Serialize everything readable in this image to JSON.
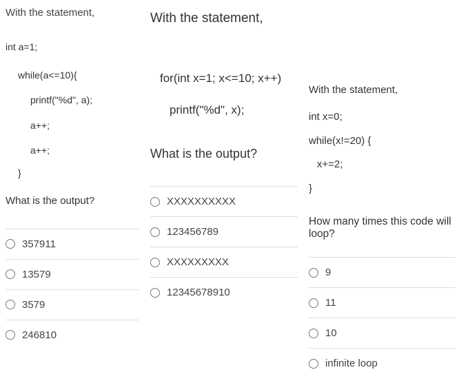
{
  "col1": {
    "intro": "With the statement,",
    "code": [
      "int a=1;",
      "while(a<=10){",
      "printf(\"%d\", a);",
      "a++;",
      "a++;",
      "}"
    ],
    "question": "What is the output?",
    "options": [
      "357911",
      "13579",
      "3579",
      "246810"
    ]
  },
  "col2": {
    "intro": "With the statement,",
    "code": [
      "for(int x=1; x<=10; x++)",
      "printf(\"%d\", x);"
    ],
    "question": "What is the output?",
    "options": [
      "XXXXXXXXXX",
      "123456789",
      "XXXXXXXXX",
      "12345678910"
    ]
  },
  "col3": {
    "intro": "With the statement,",
    "code": [
      "int x=0;",
      "while(x!=20) {",
      "x+=2;",
      "}"
    ],
    "question": "How many times this code will loop?",
    "options": [
      "9",
      "11",
      "10",
      "infinite loop"
    ]
  }
}
